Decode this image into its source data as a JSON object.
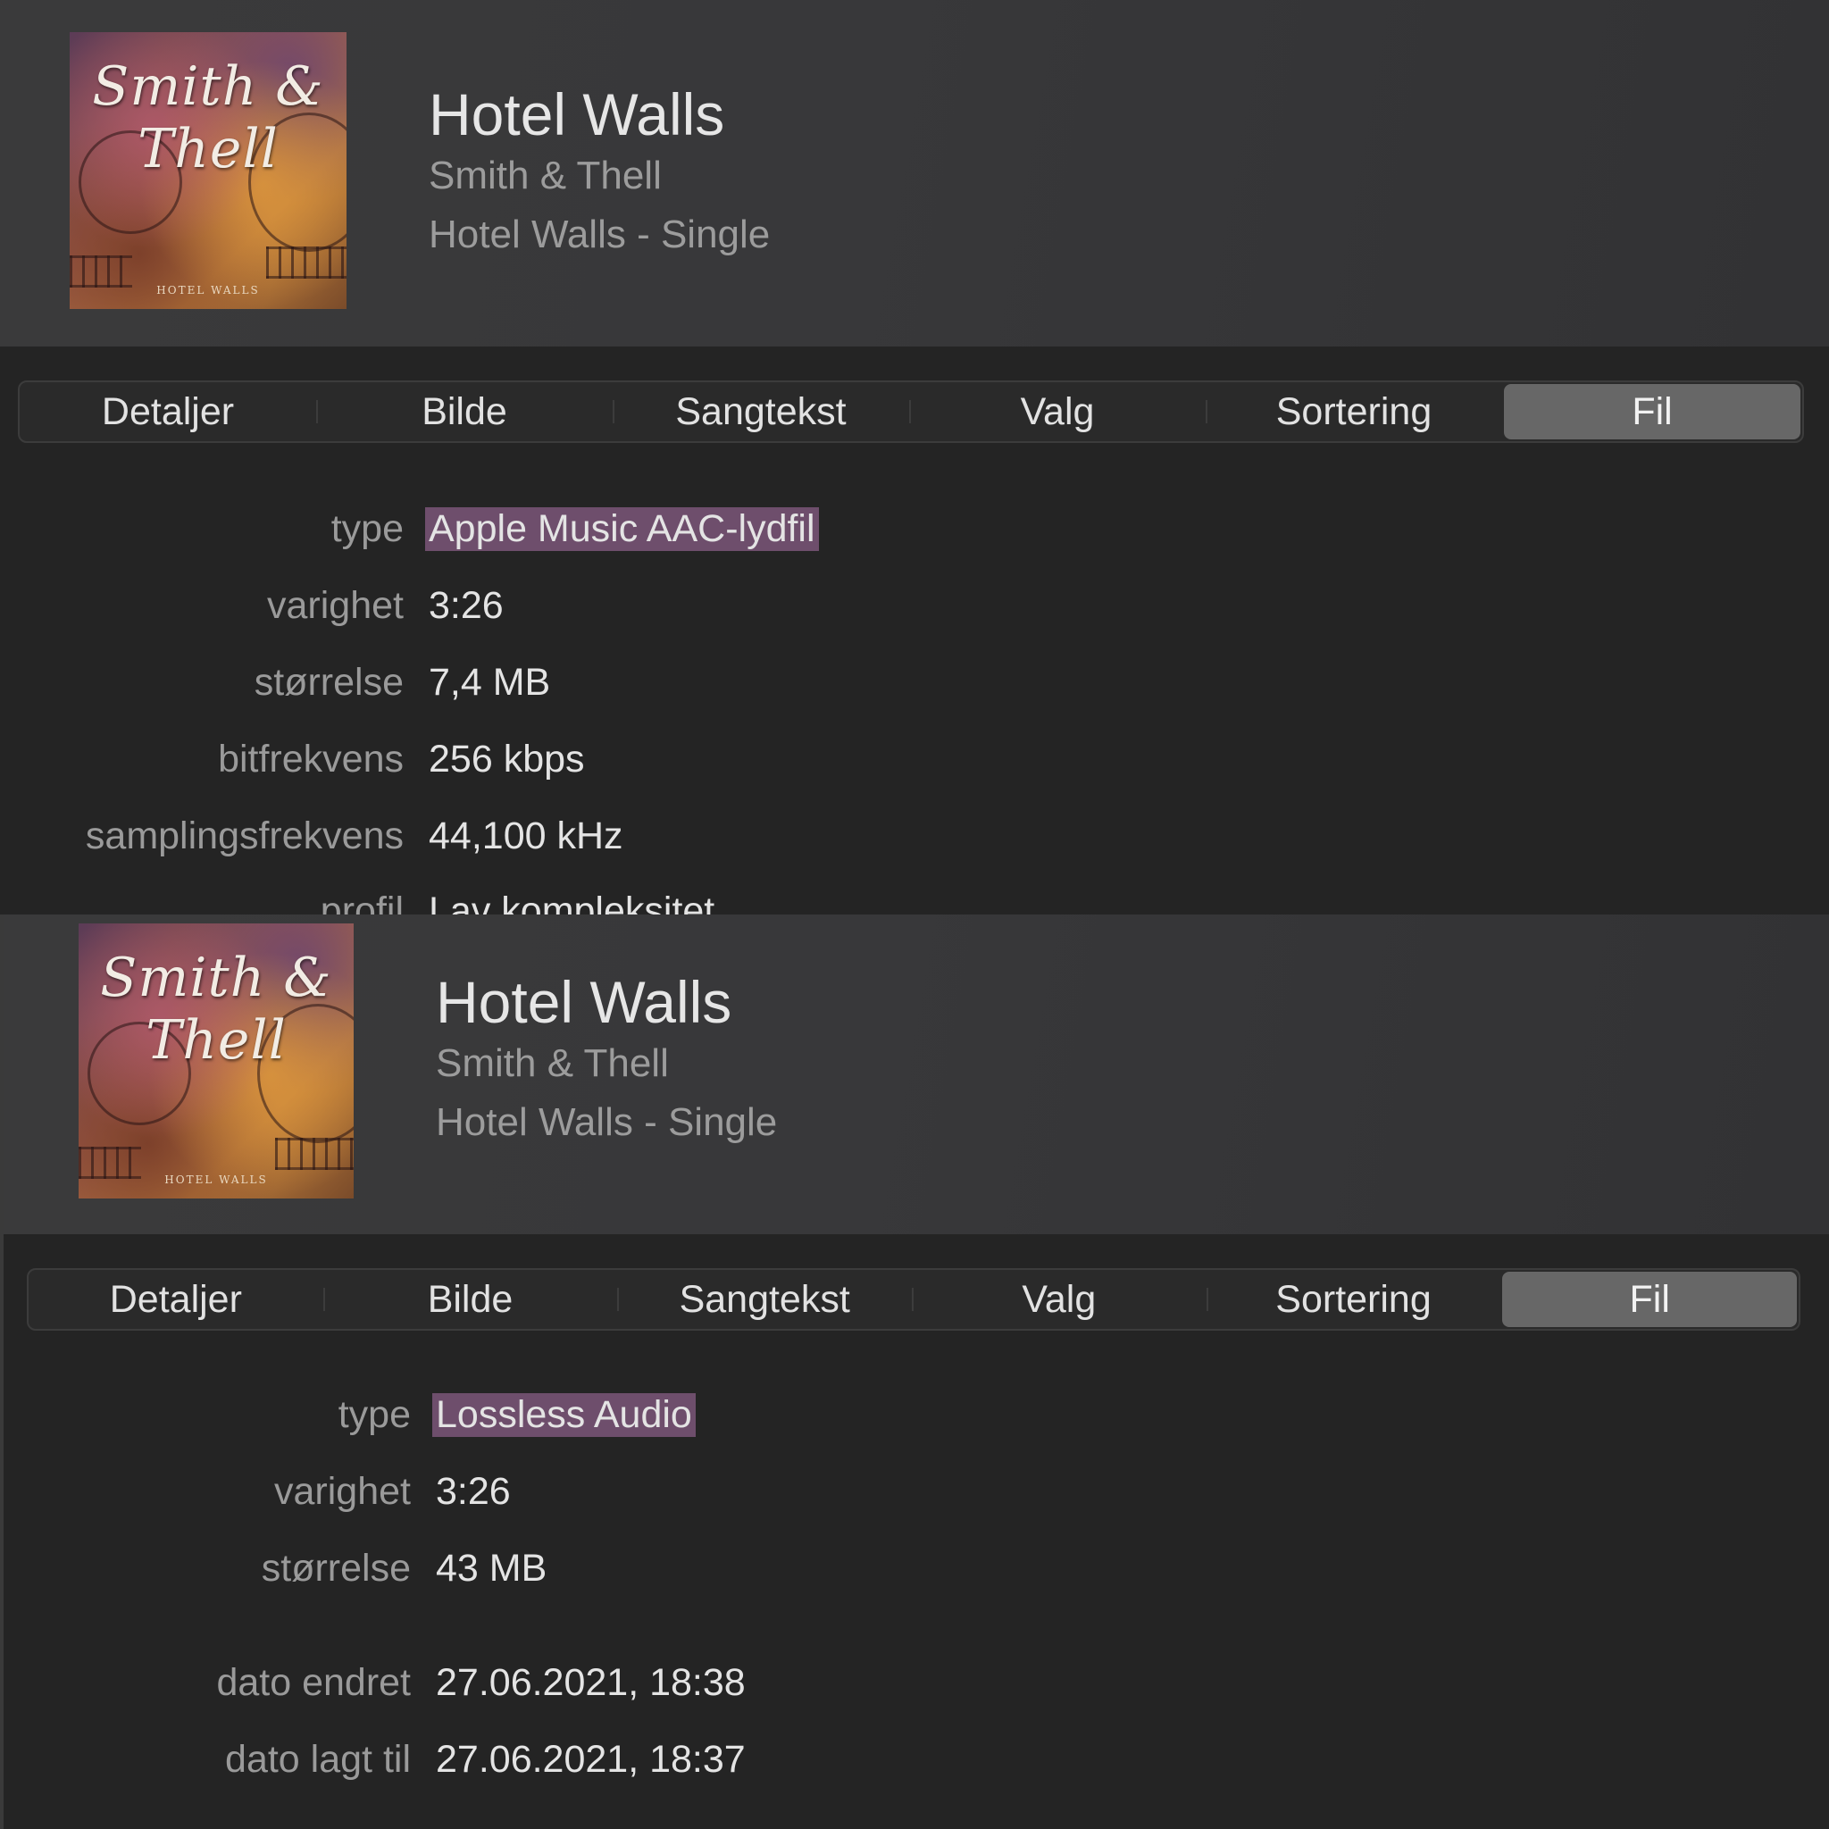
{
  "panels": {
    "top": {
      "artwork": {
        "art_title": "Smith & Thell",
        "art_subtitle": "HOTEL WALLS"
      },
      "song": {
        "title": "Hotel Walls",
        "artist": "Smith & Thell",
        "album": "Hotel Walls - Single"
      },
      "tabs": [
        {
          "label": "Detaljer"
        },
        {
          "label": "Bilde"
        },
        {
          "label": "Sangtekst"
        },
        {
          "label": "Valg"
        },
        {
          "label": "Sortering"
        },
        {
          "label": "Fil",
          "selected": true
        }
      ],
      "info": [
        {
          "label": "type",
          "value": "Apple Music AAC-lydfil",
          "highlighted": true
        },
        {
          "label": "varighet",
          "value": "3:26"
        },
        {
          "label": "størrelse",
          "value": "7,4 MB"
        },
        {
          "label": "bitfrekvens",
          "value": "256 kbps"
        },
        {
          "label": "samplingsfrekvens",
          "value": "44,100 kHz"
        },
        {
          "label": "profil",
          "value": "Lav kompleksitet"
        }
      ]
    },
    "bottom": {
      "artwork": {
        "art_title": "Smith & Thell",
        "art_subtitle": "HOTEL WALLS"
      },
      "song": {
        "title": "Hotel Walls",
        "artist": "Smith & Thell",
        "album": "Hotel Walls - Single"
      },
      "tabs": [
        {
          "label": "Detaljer"
        },
        {
          "label": "Bilde"
        },
        {
          "label": "Sangtekst"
        },
        {
          "label": "Valg"
        },
        {
          "label": "Sortering"
        },
        {
          "label": "Fil",
          "selected": true
        }
      ],
      "info": [
        {
          "label": "type",
          "value": "Lossless Audio",
          "highlighted": true
        },
        {
          "label": "varighet",
          "value": "3:26"
        },
        {
          "label": "størrelse",
          "value": "43 MB"
        },
        {
          "label": "dato endret",
          "value": "27.06.2021, 18:38"
        },
        {
          "label": "dato lagt til",
          "value": "27.06.2021, 18:37"
        }
      ]
    }
  },
  "colors": {
    "highlight": "#6e4e6c",
    "selected_tab": "#676767",
    "background": "#242424"
  }
}
